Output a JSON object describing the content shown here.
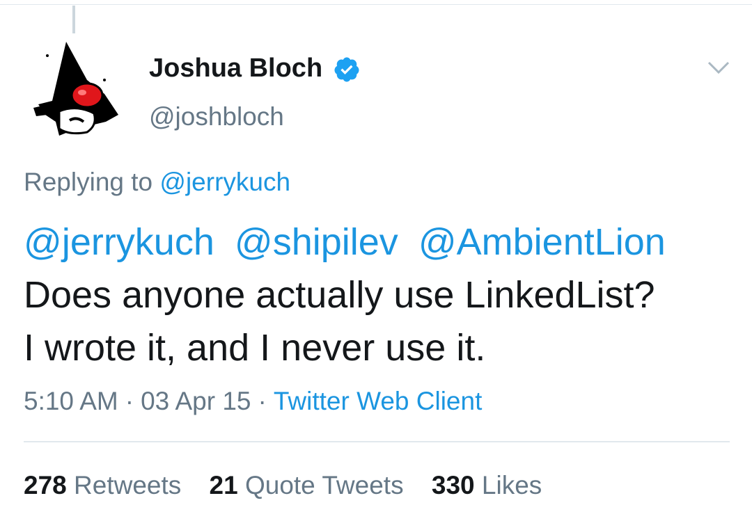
{
  "header": {
    "display_name": "Joshua Bloch",
    "handle": "@joshbloch"
  },
  "reply": {
    "prefix": "Replying to",
    "to": "@jerrykuch"
  },
  "tweet": {
    "mentions": [
      "@jerrykuch",
      "@shipilev",
      "@AmbientLion"
    ],
    "line1": "Does anyone actually use LinkedList?",
    "line2": "I wrote it, and I never use it."
  },
  "meta": {
    "time": "5:10 AM",
    "separator": "·",
    "date": "03 Apr 15",
    "source": "Twitter Web Client"
  },
  "stats": {
    "retweets_count": "278",
    "retweets_label": "Retweets",
    "quotes_count": "21",
    "quotes_label": "Quote Tweets",
    "likes_count": "330",
    "likes_label": "Likes"
  },
  "colors": {
    "link": "#1b95e0",
    "secondary_text": "#657786",
    "primary_text": "#14171a",
    "verified": "#1da1f2"
  }
}
